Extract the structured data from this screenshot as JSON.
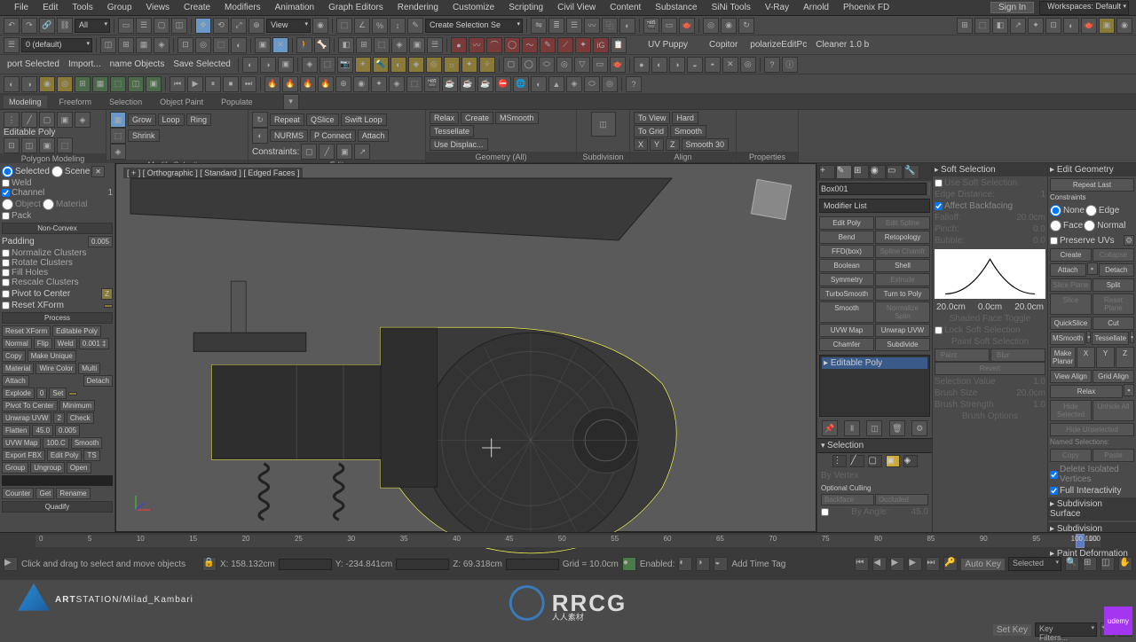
{
  "menubar": {
    "items": [
      "File",
      "Edit",
      "Tools",
      "Group",
      "Views",
      "Create",
      "Modifiers",
      "Animation",
      "Graph Editors",
      "Rendering",
      "Customize",
      "Scripting",
      "Civil View",
      "Content",
      "Substance",
      "SiNi Tools",
      "V-Ray",
      "Arnold",
      "Phoenix FD"
    ],
    "signin": "Sign In",
    "workspaces": "Workspaces: Default"
  },
  "toolbar2": {
    "default_set": "0 (default)",
    "uv_puppy": "UV Puppy",
    "copitor": "Copitor",
    "polarize": "polarizeEditPc",
    "cleaner": "Cleaner 1.0 b"
  },
  "toolbar3": {
    "port_selected": "port Selected",
    "import": "Import...",
    "name_objects": "name Objects",
    "save_selected": "Save Selected"
  },
  "tabs": {
    "items": [
      "Modeling",
      "Freeform",
      "Selection",
      "Object Paint",
      "Populate"
    ],
    "active": 0
  },
  "ribbon": {
    "poly": "Polygon Modeling",
    "epoly": "Editable Poly",
    "grow": "Grow",
    "shrink": "Shrink",
    "loop": "Loop",
    "ring": "Ring",
    "modify_sel": "Modify Selection",
    "repeat": "Repeat",
    "qslice": "QSlice",
    "swiftloop": "Swift Loop",
    "nurms": "NURMS",
    "ms_smooth": "P Connect",
    "attach": "Attach",
    "constraints": "Constraints:",
    "edit": "Edit",
    "relax": "Relax",
    "create": "Create",
    "msmooth": "MSmooth",
    "tessellate": "Tessellate",
    "use_displ": "Use Displac...",
    "geom_all": "Geometry (All)",
    "subdivision": "Subdivision",
    "make_planar": "Make Planar",
    "to_view": "To View",
    "to_grid": "To Grid",
    "x": "X",
    "y": "Y",
    "z": "Z",
    "align": "Align",
    "hard": "Hard",
    "smooth": "Smooth",
    "smooth30": "Smooth 30",
    "properties": "Properties"
  },
  "leftpanel": {
    "radio1": "Selected",
    "radio2": "Scene",
    "weld": "Weld",
    "channel": "Channel",
    "object": "Object",
    "material": "Material",
    "pack": "Pack",
    "nonconvex": "Non-Convex",
    "padding": "Padding",
    "padval": "0.005",
    "normclust": "Normalize Clusters",
    "rotclust": "Rotate Clusters",
    "fillholes": "Fill Holes",
    "rescale": "Rescale Clusters",
    "pivot": "Pivot to Center",
    "z": "Z",
    "resetx": "Reset XForm",
    "process": "Process",
    "resetxform": "Reset XForm",
    "editablepoly": "Editable Poly",
    "normal": "Normal",
    "flip": "Flip",
    "weld2": "Weld",
    "weldval": "0.001 ‡",
    "copy": "Copy",
    "paste": "Make Unique",
    "material2": "Material",
    "wirecolor": "Wire Color",
    "multi": "Multi",
    "attach": "Attach",
    "detach": "Detach",
    "explode": "Explode",
    "exval": "0",
    "set": "Set",
    "pivotcenter": "Pivot To Center",
    "min": "Minimum",
    "unwrap": "Unwrap UVW",
    "ch": "2",
    "check": "Check",
    "flatten": "Flatten",
    "flatval": "45.0",
    "flatval2": "0.005",
    "uvwmap": "UVW Map",
    "mapval": "100.C",
    "smooth": "Smooth",
    "exportfbx": "Export FBX",
    "editpoly": "Edit Poly",
    "ts": "TS",
    "group": "Group",
    "ungroup": "Ungroup",
    "open": "Open",
    "counter": "Counter",
    "get": "Get",
    "rename": "Rename",
    "quadify": "Quadify"
  },
  "viewport": {
    "label": "[ + ] [ Orthographic ] [ Standard ] [ Edged Faces ]"
  },
  "rightpanel": {
    "obj_name": "Box001",
    "modlist": "Modifier List",
    "buttons": [
      [
        "Edit Poly",
        "Edit Spline"
      ],
      [
        "Bend",
        "Retopology"
      ],
      [
        "FFD(box)",
        "Spline Chamfr"
      ],
      [
        "Boolean",
        "Shell"
      ],
      [
        "Symmetry",
        "Extrude"
      ],
      [
        "TurboSmooth",
        "Turn to Poly"
      ],
      [
        "Smooth",
        "Normalize Splin"
      ],
      [
        "UVW Map",
        "Unwrap UVW"
      ],
      [
        "Chamfer",
        "Subdivide"
      ]
    ],
    "stack_sel": "Editable Poly",
    "selection": "Selection",
    "by_vertex": "By Vertex",
    "optional_culling": "Optional Culling",
    "backface": "Backface",
    "occluded": "Occluded",
    "by_angle": "By Angle:",
    "angle": "45.0"
  },
  "softsel": {
    "title": "Soft Selection",
    "use": "Use Soft Selection",
    "edgedist": "Edge Distance:",
    "edval": "1",
    "affect": "Affect Backfacing",
    "falloff": "Falloff:",
    "fval": "20.0cm",
    "pinch": "Pinch:",
    "pval": "0.0",
    "bubble": "Bubble:",
    "bval": "0.0",
    "t1": "20.0cm",
    "t2": "0.0cm",
    "t3": "20.0cm",
    "shaded": "Shaded Face Toggle",
    "lock": "Lock Soft Selection",
    "paint": "Paint Soft Selection",
    "paintbtn": "Paint",
    "blur": "Blur",
    "revert": "Revert",
    "selval": "Selection Value",
    "sv": "1.0",
    "brushsz": "Brush Size",
    "bs": "20.0cm",
    "brushstr": "Brush Strength",
    "bst": "1.0",
    "brushopt": "Brush Options"
  },
  "editgeom": {
    "title": "Edit Geometry",
    "repeat": "Repeat Last",
    "constraints": "Constraints",
    "none": "None",
    "edge": "Edge",
    "face": "Face",
    "normal": "Normal",
    "preserve": "Preserve UVs",
    "create": "Create",
    "collapse": "Collapse",
    "attach": "Attach",
    "detach": "Detach",
    "sliceplane": "Slice Plane",
    "split": "Split",
    "slice": "Slice",
    "resetplane": "Reset Plane",
    "quickslice": "QuickSlice",
    "cut": "Cut",
    "msmooth": "MSmooth",
    "tessellate": "Tessellate",
    "makeplanar": "Make Planar",
    "x": "X",
    "y": "Y",
    "z": "Z",
    "viewalign": "View Align",
    "gridalign": "Grid Align",
    "relax": "Relax",
    "hidesel": "Hide Selected",
    "unhideall": "Unhide All",
    "hideunsel": "Hide Unselected",
    "namedsel": "Named Selections:",
    "copy": "Copy",
    "paste": "Paste",
    "delisov": "Delete Isolated Vertices",
    "fullint": "Full Interactivity",
    "subdsurf": "Subdivision Surface",
    "subddisp": "Subdivision Displacement",
    "paintdef": "Paint Deformation"
  },
  "timeline": {
    "marks": [
      "0",
      "5",
      "10",
      "15",
      "20",
      "25",
      "30",
      "35",
      "40",
      "45",
      "50",
      "55",
      "60",
      "65",
      "70",
      "75",
      "80",
      "85",
      "90",
      "95",
      "100"
    ],
    "range": "100 / 100"
  },
  "statusbar": {
    "hint": "Click and drag to select and move objects",
    "x": "X: 158.132cm",
    "y": "Y: -234.841cm",
    "z": "Z: 69.318cm",
    "grid": "Grid = 10.0cm",
    "enabled": "Enabled:",
    "addtime": "Add Time Tag",
    "autokey": "Auto Key",
    "selected": "Selected",
    "setkey": "Set Key",
    "keyfilters": "Key Filters..."
  },
  "watermark": {
    "art": "ART",
    "station": "STATION",
    "suffix": "/Milad_Kambari"
  },
  "rrcg": {
    "txt": "RRCG",
    "sub": "人人素材"
  },
  "udemy": "udemy"
}
